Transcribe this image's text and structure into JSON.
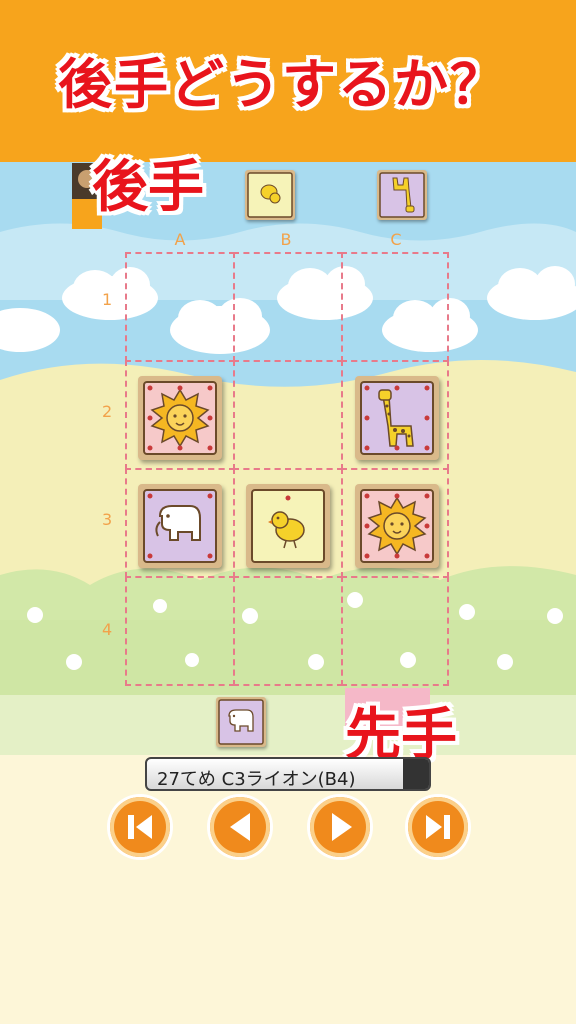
{
  "header": {
    "title": "後手どうするか？"
  },
  "board": {
    "columns": [
      "A",
      "B",
      "C"
    ],
    "rows": [
      "1",
      "2",
      "3",
      "4"
    ],
    "pieces": [
      {
        "square": "A2",
        "animal": "lion"
      },
      {
        "square": "C2",
        "animal": "giraffe"
      },
      {
        "square": "A3",
        "animal": "elephant"
      },
      {
        "square": "B3",
        "animal": "chick"
      },
      {
        "square": "C3",
        "animal": "lion"
      }
    ]
  },
  "gote": {
    "label": "後手",
    "hand": [
      "chick",
      "giraffe"
    ]
  },
  "sente": {
    "label": "先手",
    "hand": [
      "elephant"
    ]
  },
  "move_record": {
    "text": "27てめ C3ライオン(B4)"
  },
  "controls": {
    "buttons": [
      "first",
      "previous",
      "next",
      "last"
    ]
  },
  "colors": {
    "header": "#f7a41c",
    "label_red": "#e8141c",
    "button_orange": "#f08a1c",
    "grid_dash": "#e87a8a"
  }
}
